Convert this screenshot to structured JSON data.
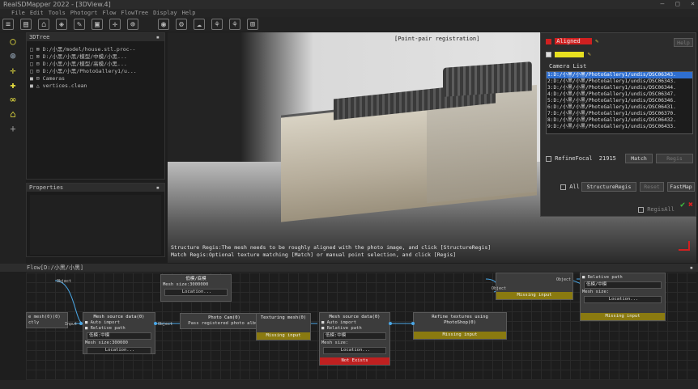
{
  "window": {
    "title": "RealSDMapper 2022 - [3DView.4]",
    "controls": [
      "–",
      "□",
      "×"
    ]
  },
  "menu": [
    "File",
    "Edit",
    "Tools",
    "Photogrt",
    "Flow",
    "FlowTree",
    "Display",
    "Help"
  ],
  "toolbar": {
    "left_icons": [
      "menu-icon",
      "save-icon",
      "open-folder-icon",
      "layers-icon",
      "brush-icon",
      "frame-icon",
      "target-icon",
      "globe-icon"
    ],
    "right_icons": [
      "camera-icon",
      "node-icon",
      "cloud-icon",
      "tree-icon",
      "tree2-icon",
      "grid-icon"
    ]
  },
  "left_tools": [
    "search-icon",
    "zoom-icon",
    "move-icon",
    "add-point-icon",
    "link-icon",
    "building-icon",
    "plus-icon"
  ],
  "tree_panel": {
    "title": "3DTree",
    "items": [
      "□ ⊠ D:/小黑/model/house.stl.proc--",
      "□ ⊠ D:/小黑/小黑/模型/中模/小黑...",
      "□ ⊟ D:/小黑/小黑/模型/高模/小黑...",
      "□ ⊟ D:/小黑/小黑/PhotoGallery1/u...",
      "  ■ ⊟ Cameras",
      "  ■ △ vertices.clean"
    ]
  },
  "properties_panel": {
    "title": "Properties"
  },
  "viewport": {
    "caption": "[Point-pair registration]",
    "status_line1": "Structure Regis:The mesh needs to be roughly aligned with the photo image, and click [StructureRegis]",
    "status_line2": "Match Regis:Optional texture matching [Match] or manual point selection, and click [Regis]"
  },
  "registration": {
    "aligned_label": "Aligned",
    "camera_list_label": "Camera List",
    "help_label": "Help",
    "cameras": [
      "1:D:/小黑/小黑/PhotoGallery1/undis/DSC06343.",
      "2:D:/小黑/小黑/PhotoGallery1/undis/DSC06343.",
      "3:D:/小黑/小黑/PhotoGallery1/undis/DSC06344.",
      "4:D:/小黑/小黑/PhotoGallery1/undis/DSC06347.",
      "5:D:/小黑/小黑/PhotoGallery1/undis/DSC06346.",
      "6:D:/小黑/小黑/PhotoGallery1/undis/DSC06431.",
      "7:D:/小黑/小黑/PhotoGallery1/undis/DSC06370.",
      "8:D:/小黑/小黑/PhotoGallery1/undis/DSC06432.",
      "9:D:/小黑/小黑/PhotoGallery1/undis/DSC06433."
    ],
    "selected_index": 1,
    "refine_focal_label": "RefineFocal",
    "refine_focal_value": "21915",
    "match_label": "Match",
    "regis_label": "Regis",
    "all_label": "All",
    "structure_regis_label": "StructureRegis",
    "reset_label": "Reset",
    "fastmap_label": "FastMap",
    "regis_all_label": "RegisAll",
    "accent_red": "#d02020",
    "selection_blue": "#2f6fd0"
  },
  "flow": {
    "title": "Flow[D:/小黑/小黑]",
    "nodes": {
      "mesh_top": {
        "title": "低模/底模",
        "line1": "Mesh size:3000000",
        "button": "Location..."
      },
      "mesh_left": {
        "title": "Mesh source data(0)",
        "opt1": "■ Auto import",
        "opt2": "■ Relative path",
        "field": "低模:中模",
        "size": "Mesh size:300000",
        "button": "Location..."
      },
      "photo_cam": {
        "title": "Photo Cam(0)",
        "sub": "Pass registered photo album"
      },
      "texture_mesh": {
        "title": "Texturing mesh(0)",
        "foot": "Missing input"
      },
      "mesh_right": {
        "title": "Mesh source data(0)",
        "opt1": "■ Auto import",
        "opt2": "■ Relative path",
        "field": "低模:中模",
        "size": "Mesh size:",
        "button": "Location...",
        "foot": "Not Exists"
      },
      "refine_tex": {
        "title": "Refine textures using PhotoShop(0)",
        "foot": "Missing input"
      },
      "top_mid": {
        "foot": "Missing input"
      },
      "top_right": {
        "opt": "■ Relative path",
        "field": "低模/中模",
        "size": "Mesh size:",
        "button": "Location...",
        "foot": "Missing input"
      },
      "left_edge": {
        "title": "e mesh(0)(0)",
        "sub": "ctly"
      }
    },
    "ports": {
      "object": "Object",
      "input": "Input"
    }
  }
}
